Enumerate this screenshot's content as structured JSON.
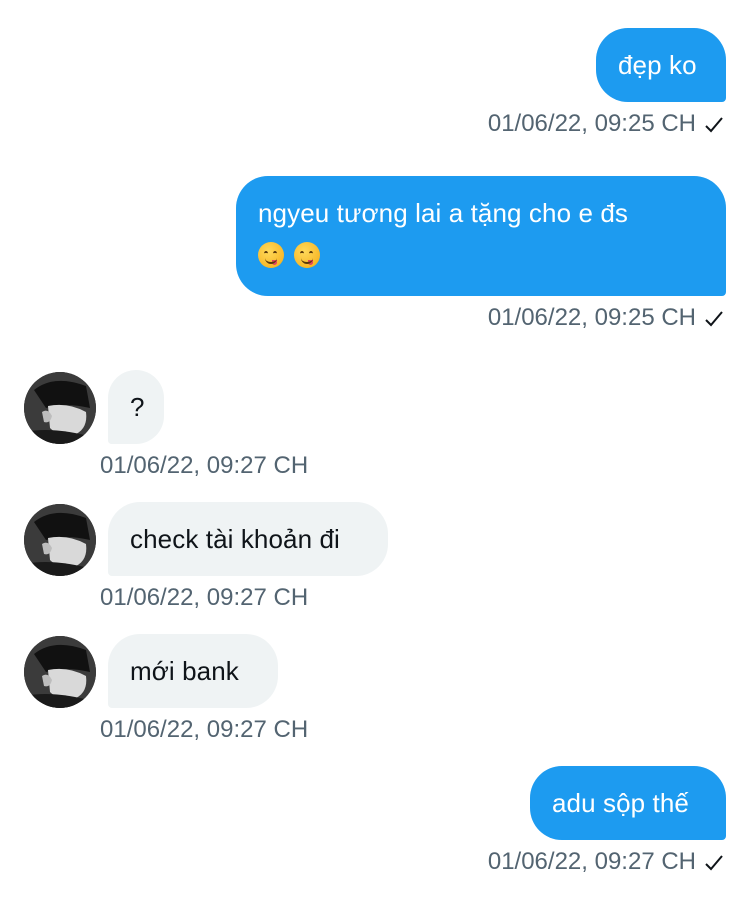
{
  "conversation": {
    "messages": [
      {
        "direction": "out",
        "text": "đẹp ko",
        "time": "01/06/22, 09:25 CH",
        "status": "sent"
      },
      {
        "direction": "out",
        "text": "ngyeu tương lai a tặng cho e đs",
        "emojis": [
          "yum-face",
          "yum-face"
        ],
        "time": "01/06/22, 09:25 CH",
        "status": "sent"
      },
      {
        "direction": "in",
        "text": "?",
        "time": "01/06/22, 09:27 CH"
      },
      {
        "direction": "in",
        "text": "check tài khoản đi",
        "time": "01/06/22, 09:27 CH"
      },
      {
        "direction": "in",
        "text": "mới bank",
        "time": "01/06/22, 09:27 CH"
      },
      {
        "direction": "out",
        "text": "adu sộp thế",
        "time": "01/06/22, 09:27 CH",
        "status": "sent"
      }
    ]
  },
  "icons": {
    "status_icon": "check-icon",
    "emoji_icon": "face-savoring-food-emoji",
    "avatar": "contact-avatar"
  },
  "colors": {
    "outgoing_bubble": "#1d9bf0",
    "incoming_bubble": "#eff3f4",
    "timestamp": "#536471"
  }
}
